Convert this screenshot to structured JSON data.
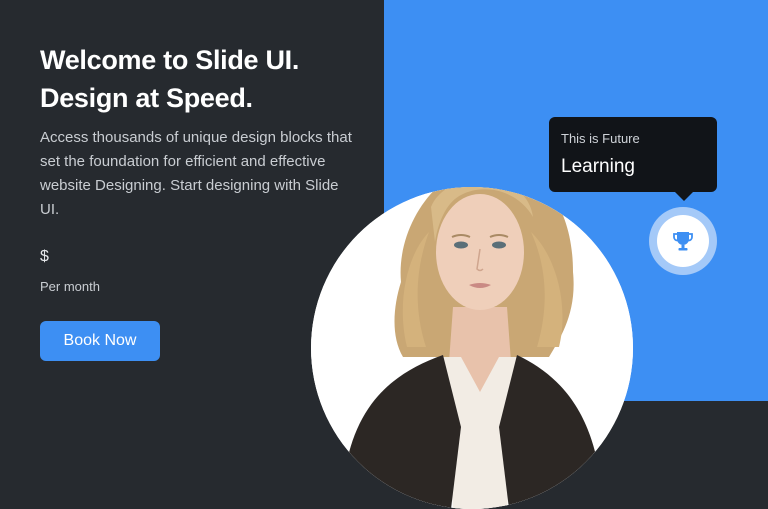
{
  "hero": {
    "headline_line1": "Welcome to Slide UI.",
    "headline_line2": "Design at Speed.",
    "description": "Access thousands of unique design blocks that set the foundation for efficient and effective website Designing. Start designing with Slide UI.",
    "price": "$",
    "period": "Per month",
    "cta_label": "Book Now"
  },
  "tooltip": {
    "subtitle": "This is Future",
    "title": "Learning"
  },
  "icons": {
    "badge": "trophy-icon",
    "photo": "person-photo"
  },
  "colors": {
    "dark_panel": "#262a2f",
    "accent_blue": "#3d8ff3",
    "tooltip_bg": "#111418",
    "ring": "#a4c9f8"
  }
}
